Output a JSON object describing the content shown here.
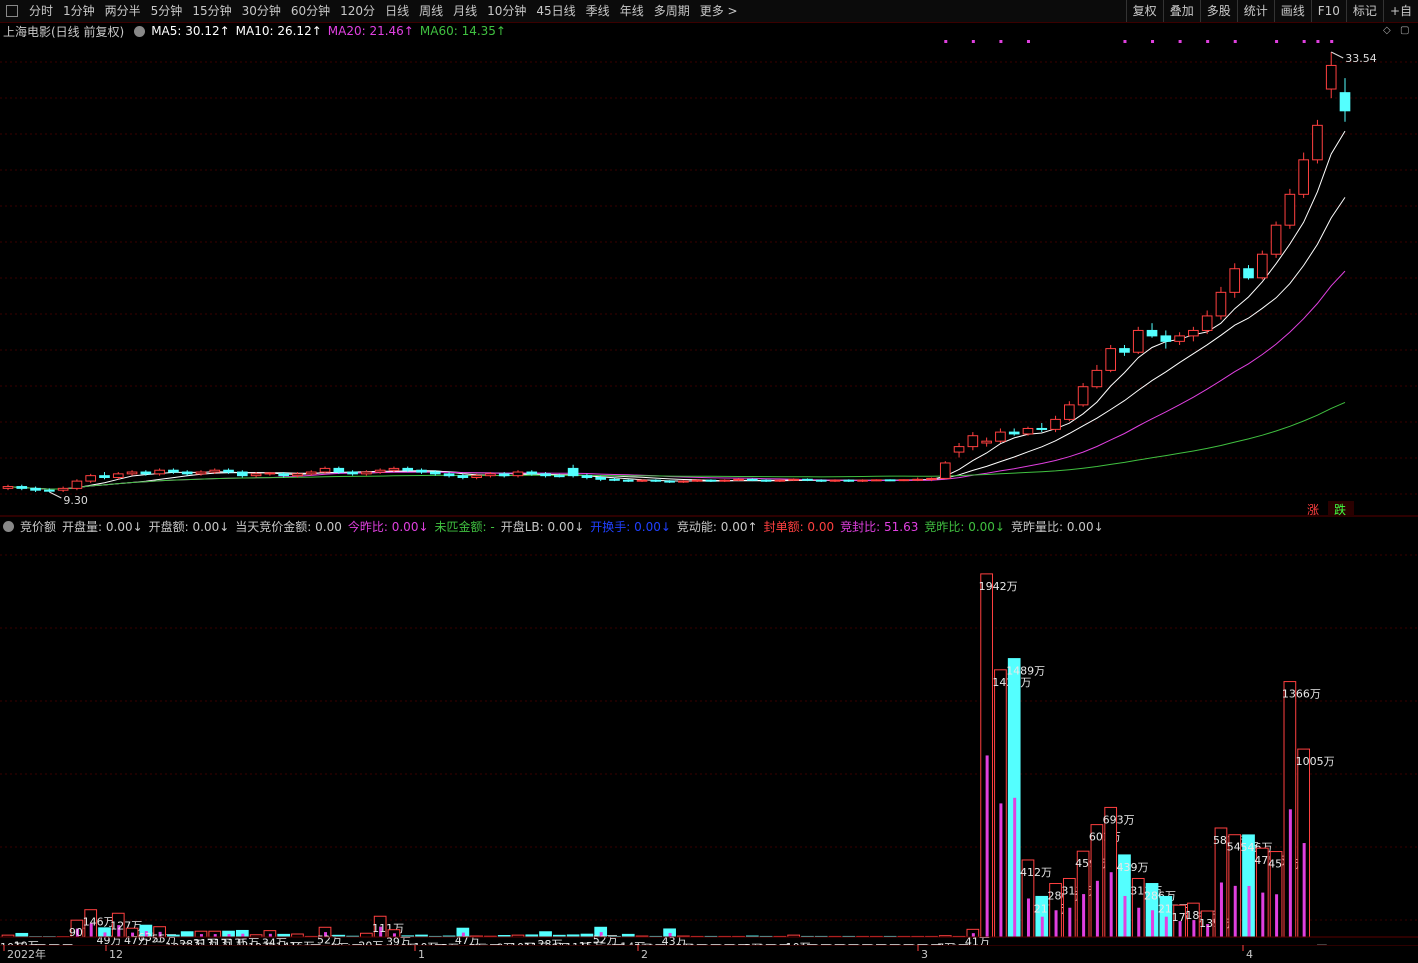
{
  "toolbar": {
    "periods": [
      "分时",
      "1分钟",
      "两分半",
      "5分钟",
      "15分钟",
      "30分钟",
      "60分钟",
      "120分",
      "日线",
      "周线",
      "月线",
      "10分钟",
      "45日线",
      "季线",
      "年线",
      "多周期",
      "更多 >"
    ],
    "right": [
      "复权",
      "叠加",
      "多股",
      "统计",
      "画线",
      "F10",
      "标记",
      "+自"
    ]
  },
  "price_legend": {
    "title": "上海电影(日线 前复权)",
    "ma5": "MA5: 30.12↑",
    "ma10": "MA10: 26.12↑",
    "ma20": "MA20: 21.46↑",
    "ma60": "MA60: 14.35↑"
  },
  "colors": {
    "up": "#ff4040",
    "down": "#54ffff",
    "ma5": "#ffffff",
    "ma10": "#ffffff",
    "ma20": "#e040e0",
    "ma60": "#40c040",
    "grid": "#3a0000"
  },
  "price_labels": {
    "high": "33.54",
    "low": "9.30",
    "zhang": "涨",
    "die": "跌"
  },
  "volume_legend": {
    "title": "竞价额",
    "items": [
      {
        "text": "开盘量: 0.00↓",
        "color": "#c8c8c8"
      },
      {
        "text": "开盘额: 0.00↓",
        "color": "#c8c8c8"
      },
      {
        "text": "当天竞价金额: 0.00",
        "color": "#c8c8c8"
      },
      {
        "text": "今昨比: 0.00↓",
        "color": "#e040e0"
      },
      {
        "text": "未匹金额: -",
        "color": "#40c040"
      },
      {
        "text": "开盘LB: 0.00↓",
        "color": "#c8c8c8"
      },
      {
        "text": "开换手: 0.00↓",
        "color": "#2040ff"
      },
      {
        "text": "竞动能: 0.00↑",
        "color": "#c8c8c8"
      },
      {
        "text": "封单额: 0.00",
        "color": "#ff4040"
      },
      {
        "text": "竞封比: 51.63",
        "color": "#e040e0"
      },
      {
        "text": "竞昨比: 0.00↓",
        "color": "#40c040"
      },
      {
        "text": "竞昨量比: 0.00↓",
        "color": "#c8c8c8"
      }
    ]
  },
  "date_axis": [
    "2022年",
    "12",
    "1",
    "2",
    "3",
    "4"
  ],
  "volume_labels": [
    "1942万",
    "1489万",
    "1429万",
    "412万",
    "459万",
    "601万",
    "693万",
    "439万",
    "313万",
    "286万",
    "217万",
    "583万",
    "546万",
    "475万",
    "457万",
    "413万",
    "347万",
    "170万",
    "181万",
    "139万",
    "1005万",
    "1366万",
    "15万",
    "111万",
    "146万",
    "127万",
    "0万",
    "41万",
    "52万",
    "43万",
    "31万",
    "10万",
    "9万",
    "7万",
    "6万",
    "2万",
    "3万",
    "4万",
    "5万"
  ],
  "chart_data": {
    "type": "candlestick_with_volume",
    "ylim_price": [
      9.3,
      33.54
    ],
    "candles": [
      [
        9.5,
        9.7,
        9.4,
        9.6
      ],
      [
        9.6,
        9.7,
        9.4,
        9.5
      ],
      [
        9.5,
        9.6,
        9.3,
        9.4
      ],
      [
        9.4,
        9.5,
        9.3,
        9.35
      ],
      [
        9.4,
        9.6,
        9.3,
        9.5
      ],
      [
        9.5,
        10.0,
        9.4,
        9.9
      ],
      [
        9.9,
        10.3,
        9.8,
        10.2
      ],
      [
        10.2,
        10.4,
        10.0,
        10.1
      ],
      [
        10.1,
        10.4,
        10.0,
        10.3
      ],
      [
        10.3,
        10.5,
        10.2,
        10.4
      ],
      [
        10.4,
        10.5,
        10.2,
        10.3
      ],
      [
        10.3,
        10.6,
        10.2,
        10.5
      ],
      [
        10.5,
        10.6,
        10.3,
        10.4
      ],
      [
        10.4,
        10.5,
        10.2,
        10.3
      ],
      [
        10.3,
        10.5,
        10.2,
        10.4
      ],
      [
        10.4,
        10.6,
        10.3,
        10.5
      ],
      [
        10.5,
        10.6,
        10.3,
        10.4
      ],
      [
        10.4,
        10.5,
        10.1,
        10.2
      ],
      [
        10.2,
        10.4,
        10.1,
        10.3
      ],
      [
        10.3,
        10.4,
        10.2,
        10.35
      ],
      [
        10.3,
        10.4,
        10.1,
        10.2
      ],
      [
        10.2,
        10.4,
        10.1,
        10.3
      ],
      [
        10.3,
        10.5,
        10.2,
        10.4
      ],
      [
        10.4,
        10.7,
        10.3,
        10.6
      ],
      [
        10.6,
        10.7,
        10.3,
        10.4
      ],
      [
        10.4,
        10.5,
        10.2,
        10.3
      ],
      [
        10.3,
        10.5,
        10.2,
        10.4
      ],
      [
        10.4,
        10.6,
        10.3,
        10.5
      ],
      [
        10.5,
        10.7,
        10.4,
        10.6
      ],
      [
        10.6,
        10.7,
        10.4,
        10.5
      ],
      [
        10.5,
        10.6,
        10.3,
        10.4
      ],
      [
        10.4,
        10.5,
        10.2,
        10.3
      ],
      [
        10.3,
        10.4,
        10.1,
        10.2
      ],
      [
        10.2,
        10.3,
        10.0,
        10.1
      ],
      [
        10.1,
        10.3,
        10.0,
        10.2
      ],
      [
        10.2,
        10.4,
        10.1,
        10.3
      ],
      [
        10.3,
        10.4,
        10.1,
        10.2
      ],
      [
        10.2,
        10.5,
        10.1,
        10.4
      ],
      [
        10.4,
        10.5,
        10.2,
        10.3
      ],
      [
        10.3,
        10.4,
        10.1,
        10.2
      ],
      [
        10.2,
        10.3,
        10.1,
        10.15
      ],
      [
        10.6,
        10.8,
        10.1,
        10.2
      ],
      [
        10.2,
        10.3,
        10.0,
        10.1
      ],
      [
        10.1,
        10.2,
        9.9,
        10.0
      ],
      [
        10.0,
        10.1,
        9.9,
        9.95
      ],
      [
        9.95,
        10.0,
        9.85,
        9.9
      ],
      [
        9.9,
        10.0,
        9.85,
        9.95
      ],
      [
        9.95,
        10.0,
        9.85,
        9.9
      ],
      [
        9.9,
        9.95,
        9.8,
        9.85
      ],
      [
        9.85,
        9.95,
        9.8,
        9.9
      ],
      [
        9.9,
        10.0,
        9.85,
        9.95
      ],
      [
        9.95,
        10.0,
        9.85,
        9.9
      ],
      [
        9.9,
        10.0,
        9.85,
        9.95
      ],
      [
        9.95,
        10.05,
        9.9,
        10.0
      ],
      [
        10.0,
        10.05,
        9.9,
        9.95
      ],
      [
        9.95,
        10.0,
        9.85,
        9.9
      ],
      [
        9.9,
        10.0,
        9.85,
        9.95
      ],
      [
        9.95,
        10.05,
        9.9,
        10.0
      ],
      [
        10.0,
        10.05,
        9.9,
        9.95
      ],
      [
        9.95,
        10.0,
        9.85,
        9.9
      ],
      [
        9.9,
        10.0,
        9.85,
        9.95
      ],
      [
        9.95,
        10.0,
        9.85,
        9.9
      ],
      [
        9.9,
        10.0,
        9.85,
        9.95
      ],
      [
        9.95,
        10.0,
        9.9,
        9.97
      ],
      [
        9.97,
        10.0,
        9.9,
        9.95
      ],
      [
        9.95,
        10.0,
        9.9,
        9.98
      ],
      [
        9.98,
        10.1,
        9.9,
        10.0
      ],
      [
        10.0,
        10.1,
        9.9,
        10.05
      ],
      [
        10.05,
        11.0,
        10.0,
        10.9
      ],
      [
        11.5,
        12.0,
        11.2,
        11.8
      ],
      [
        11.8,
        12.6,
        11.6,
        12.4
      ],
      [
        12.0,
        12.3,
        11.8,
        12.1
      ],
      [
        12.1,
        12.8,
        12.0,
        12.6
      ],
      [
        12.6,
        12.8,
        12.4,
        12.5
      ],
      [
        12.5,
        12.9,
        12.4,
        12.8
      ],
      [
        12.8,
        13.1,
        12.6,
        12.75
      ],
      [
        12.75,
        13.5,
        12.6,
        13.3
      ],
      [
        13.3,
        14.3,
        13.2,
        14.1
      ],
      [
        14.1,
        15.3,
        14.0,
        15.1
      ],
      [
        15.1,
        16.3,
        15.0,
        16.0
      ],
      [
        16.0,
        17.4,
        15.9,
        17.2
      ],
      [
        17.2,
        17.4,
        16.8,
        17.0
      ],
      [
        17.0,
        18.4,
        16.9,
        18.2
      ],
      [
        18.2,
        18.6,
        17.8,
        17.9
      ],
      [
        17.9,
        18.2,
        17.2,
        17.6
      ],
      [
        17.6,
        18.1,
        17.4,
        17.9
      ],
      [
        17.9,
        18.4,
        17.6,
        18.2
      ],
      [
        18.2,
        19.3,
        18.0,
        19.0
      ],
      [
        19.0,
        20.6,
        18.8,
        20.3
      ],
      [
        20.3,
        21.9,
        20.0,
        21.6
      ],
      [
        21.6,
        21.8,
        21.0,
        21.1
      ],
      [
        21.1,
        22.6,
        21.0,
        22.4
      ],
      [
        22.4,
        24.2,
        22.2,
        24.0
      ],
      [
        24.0,
        26.0,
        23.8,
        25.7
      ],
      [
        25.7,
        28.0,
        25.5,
        27.6
      ],
      [
        27.6,
        29.8,
        27.4,
        29.5
      ],
      [
        31.5,
        33.54,
        31.0,
        32.8
      ],
      [
        31.3,
        32.1,
        29.7,
        30.3
      ]
    ],
    "volume_10k": [
      10,
      19,
      2,
      2,
      2,
      90,
      146,
      49,
      127,
      47,
      63,
      55,
      10,
      28,
      31,
      31,
      31,
      35,
      12,
      34,
      14,
      16,
      3,
      52,
      9,
      4,
      20,
      111,
      39,
      6,
      10,
      3,
      5,
      47,
      5,
      4,
      8,
      10,
      11,
      28,
      9,
      11,
      15,
      52,
      3,
      14,
      5,
      3,
      43,
      5,
      3,
      3,
      3,
      3,
      5,
      3,
      3,
      10,
      3,
      3,
      3,
      3,
      3,
      3,
      3,
      3,
      3,
      3,
      7,
      3,
      41,
      1942,
      1429,
      1489,
      412,
      217,
      286,
      313,
      459,
      601,
      693,
      439,
      313,
      286,
      217,
      170,
      181,
      139,
      583,
      547,
      546,
      475,
      457,
      1366,
      1005,
      0
    ]
  }
}
